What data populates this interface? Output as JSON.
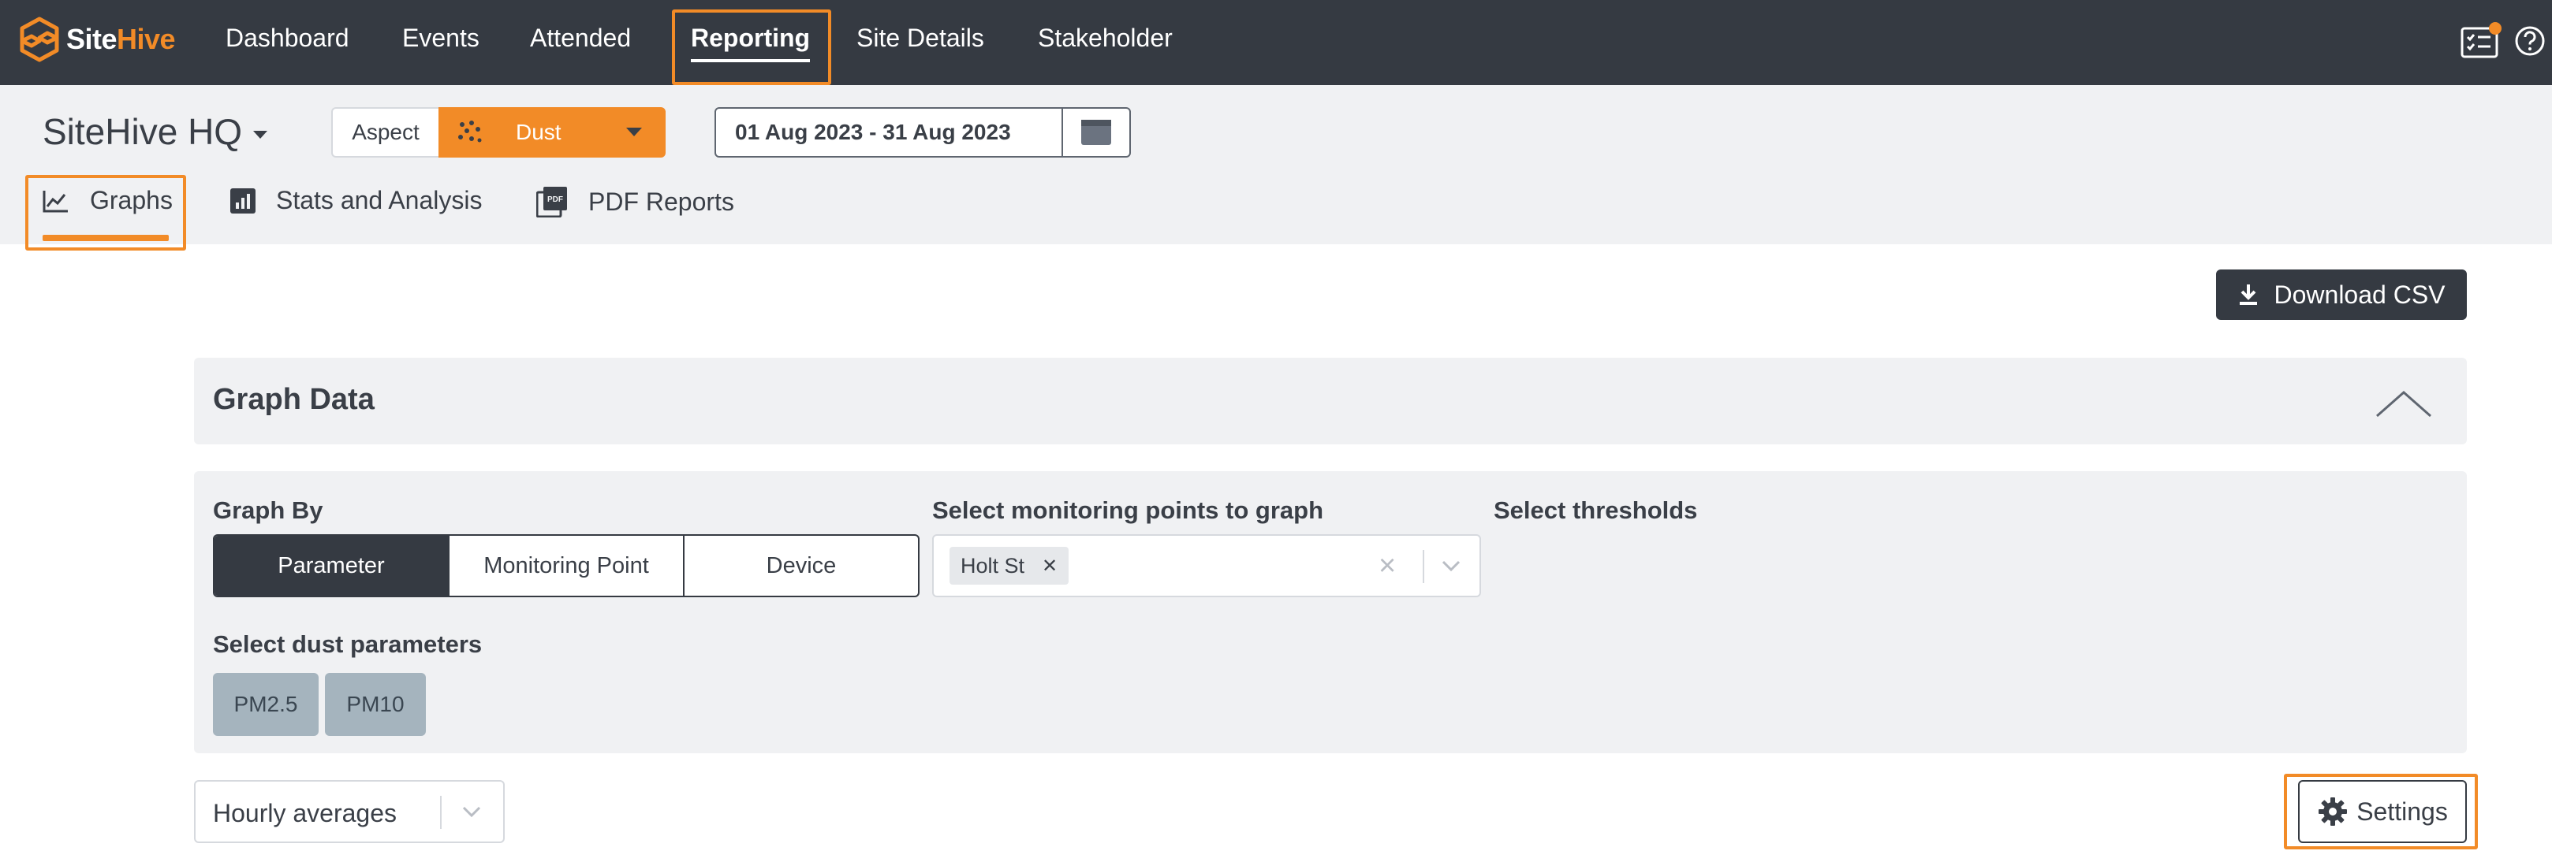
{
  "brand": {
    "name_part1": "Site",
    "name_part2": "Hive",
    "accent": "#f28b27",
    "nav_bg": "#353a42"
  },
  "nav": {
    "items": [
      {
        "label": "Dashboard"
      },
      {
        "label": "Events"
      },
      {
        "label": "Attended"
      },
      {
        "label": "Reporting",
        "active": true
      },
      {
        "label": "Site Details"
      },
      {
        "label": "Stakeholder"
      }
    ],
    "icons": [
      "checklist-icon",
      "help-icon"
    ]
  },
  "site": {
    "title": "SiteHive HQ"
  },
  "aspect": {
    "label": "Aspect",
    "value": "Dust"
  },
  "date_range": {
    "value": "01 Aug 2023 - 31 Aug 2023"
  },
  "tabs": [
    {
      "label": "Graphs",
      "active": true
    },
    {
      "label": "Stats and Analysis"
    },
    {
      "label": "PDF Reports"
    }
  ],
  "download": {
    "label": "Download CSV"
  },
  "graph_data": {
    "title": "Graph Data",
    "graph_by": {
      "label": "Graph By",
      "options": [
        "Parameter",
        "Monitoring Point",
        "Device"
      ],
      "selected": "Parameter"
    },
    "monitoring_points": {
      "label": "Select monitoring points to graph",
      "selected": [
        "Holt St"
      ]
    },
    "thresholds": {
      "label": "Select thresholds"
    },
    "dust_parameters": {
      "label": "Select dust parameters",
      "options": [
        "PM2.5",
        "PM10"
      ]
    }
  },
  "averaging": {
    "value": "Hourly averages"
  },
  "settings": {
    "label": "Settings"
  }
}
